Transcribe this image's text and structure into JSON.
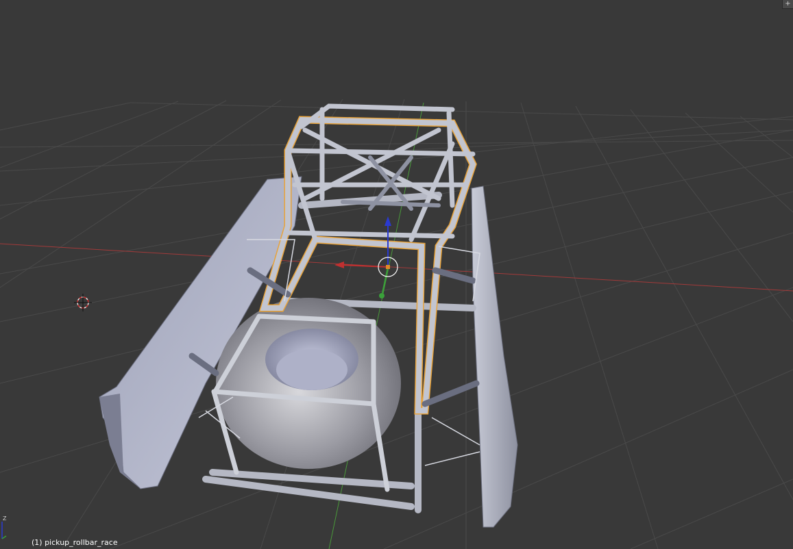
{
  "viewport": {
    "object_label": "(1) pickup_rollbar_race",
    "corner_widget_glyph": "+",
    "mini_axis_label": "Z"
  },
  "colors": {
    "background": "#393939",
    "grid": "#4a4a4a",
    "x_axis": "#a33a3a",
    "y_axis": "#4a9a3a",
    "z_axis": "#2a3ad0",
    "selection_outline": "#e8a33a",
    "mesh": "#b8bcc8"
  },
  "icons": {
    "cursor": "3d-cursor-icon",
    "manipulator": "transform-manipulator-icon",
    "corner": "split-area-icon",
    "mini_axis": "view-axis-icon"
  }
}
